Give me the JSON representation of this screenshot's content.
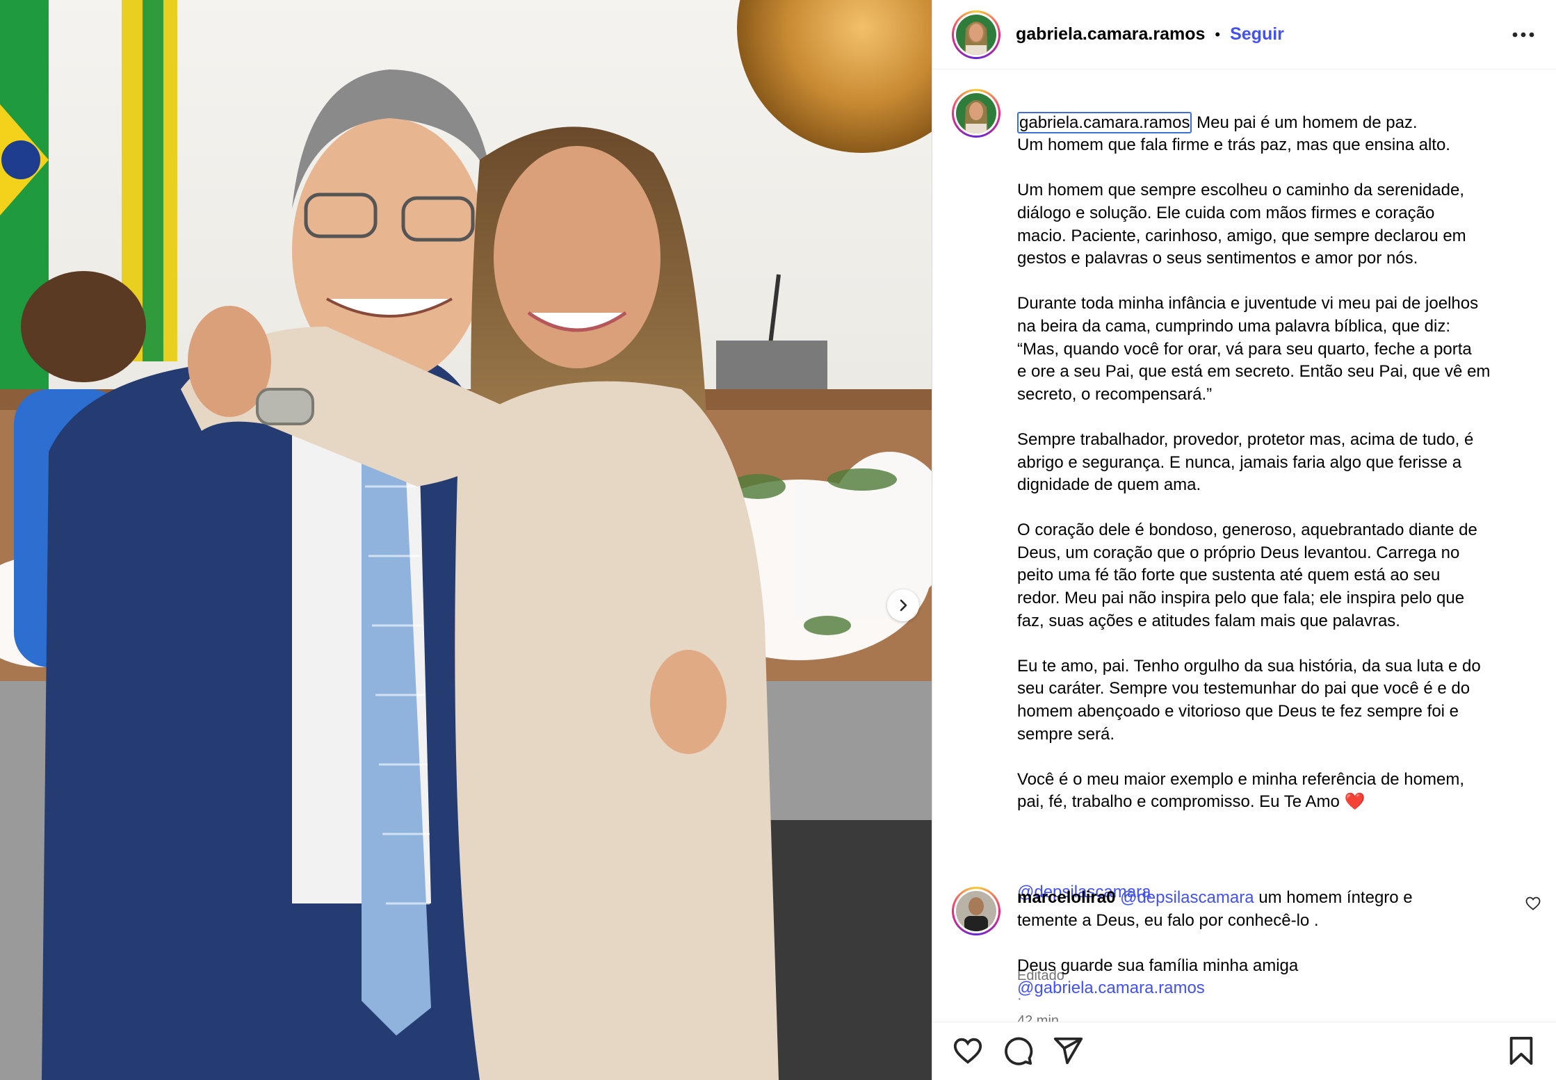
{
  "post": {
    "username": "gabriela.camara.ramos",
    "separator": "•",
    "follow_label": "Seguir",
    "more_icon": "more-horizontal-icon",
    "caption_lines": [
      "Meu pai é um homem de paz.",
      "Um homem que fala firme e trás paz, mas que ensina alto.",
      "",
      "Um homem que sempre escolheu o caminho da serenidade,",
      "diálogo e solução. Ele cuida com mãos firmes e coração",
      "macio. Paciente, carinhoso, amigo, que sempre declarou em",
      "gestos e palavras o seus sentimentos e amor por nós.",
      "",
      "Durante toda minha infância e juventude vi meu pai de joelhos",
      "na beira da cama, cumprindo uma palavra bíblica, que diz:",
      "“Mas, quando você for orar, vá para seu quarto, feche a porta",
      "e ore a seu Pai, que está em secreto. Então seu Pai, que vê em",
      "secreto, o recompensará.”",
      "",
      "Sempre trabalhador, provedor, protetor mas, acima de tudo, é",
      "abrigo e segurança. E nunca, jamais faria algo que ferisse a",
      "dignidade de quem ama.",
      "",
      "O coração dele é bondoso, generoso, aquebrantado diante de",
      "Deus, um coração que o próprio Deus levantou. Carrega no",
      "peito uma fé tão forte que sustenta até quem está ao seu",
      "redor. Meu pai não inspira pelo que fala; ele inspira pelo que",
      "faz, suas ações e atitudes falam mais que palavras.",
      "",
      "Eu te amo, pai. Tenho orgulho da sua história, da sua luta e do",
      "seu caráter. Sempre vou testemunhar do pai que você é e do",
      "homem abençoado e vitorioso que Deus te fez sempre foi e",
      "sempre será.",
      "",
      "Você é o meu maior exemplo e minha referência de homem,",
      "pai, fé, trabalho e compromisso. Eu Te Amo"
    ],
    "caption_emoji": "❤️",
    "caption_mention": "@depsilascamara",
    "edited_label": "Editado",
    "meta_separator": "·",
    "time_ago": "42 min"
  },
  "comment": {
    "username": "marcelolira0",
    "mention": "@depsilascamara",
    "text_part1": " um homem íntegro e\ntemente a Deus, eu falo por conhecê-lo .\n\nDeus guarde sua família minha amiga\n",
    "mention2": "@gabriela.camara.ramos"
  },
  "actions": {
    "like_icon": "heart-icon",
    "comment_icon": "comment-icon",
    "share_icon": "send-icon",
    "save_icon": "bookmark-icon"
  },
  "colors": {
    "accent": "#4150f7",
    "link_highlight": "#3b6fd6",
    "meta": "#737373",
    "border": "#dbdbdb"
  }
}
